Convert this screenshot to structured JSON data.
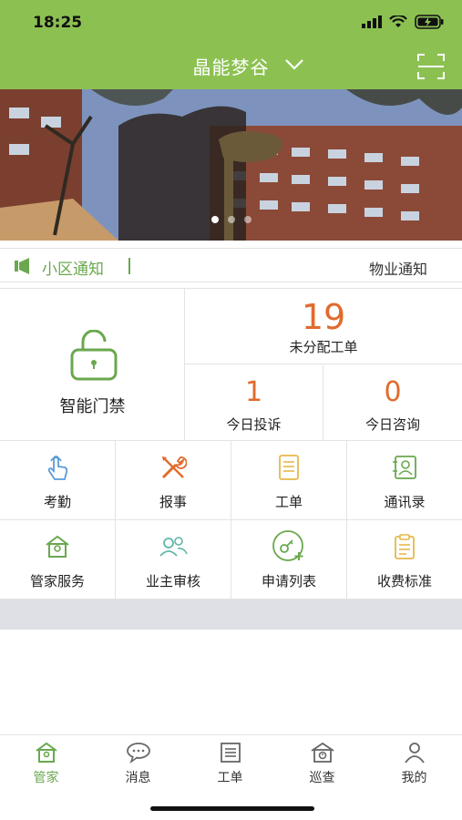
{
  "status_bar": {
    "time": "18:25"
  },
  "header": {
    "title": "晶能梦谷",
    "dropdown_icon": "chevron-down-icon",
    "scan_icon": "scan-icon"
  },
  "banner": {
    "slides": 3,
    "active_slide": 1
  },
  "notice": {
    "label": "小区通知",
    "ticker": "物业通知"
  },
  "access": {
    "label": "智能门禁",
    "icon": "lock-icon"
  },
  "stats": {
    "unassigned": {
      "value": "19",
      "label": "未分配工单"
    },
    "complaints": {
      "value": "1",
      "label": "今日投诉"
    },
    "consults": {
      "value": "0",
      "label": "今日咨询"
    }
  },
  "functions": [
    {
      "label": "考勤",
      "icon": "touch-icon"
    },
    {
      "label": "报事",
      "icon": "tools-icon"
    },
    {
      "label": "工单",
      "icon": "document-icon"
    },
    {
      "label": "通讯录",
      "icon": "contacts-icon"
    },
    {
      "label": "管家服务",
      "icon": "house-icon"
    },
    {
      "label": "业主审核",
      "icon": "users-icon"
    },
    {
      "label": "申请列表",
      "icon": "key-add-icon"
    },
    {
      "label": "收费标准",
      "icon": "clipboard-icon"
    }
  ],
  "tabs": [
    {
      "label": "管家",
      "icon": "house-icon",
      "active": true
    },
    {
      "label": "消息",
      "icon": "chat-icon",
      "active": false
    },
    {
      "label": "工单",
      "icon": "list-icon",
      "active": false
    },
    {
      "label": "巡查",
      "icon": "patrol-icon",
      "active": false
    },
    {
      "label": "我的",
      "icon": "person-icon",
      "active": false
    }
  ],
  "colors": {
    "primary": "#8cc152",
    "accent_green": "#6aa84f",
    "orange": "#e06b2d",
    "gold": "#e6b84a",
    "teal": "#5fb8a8",
    "blue": "#5b9bd5"
  }
}
